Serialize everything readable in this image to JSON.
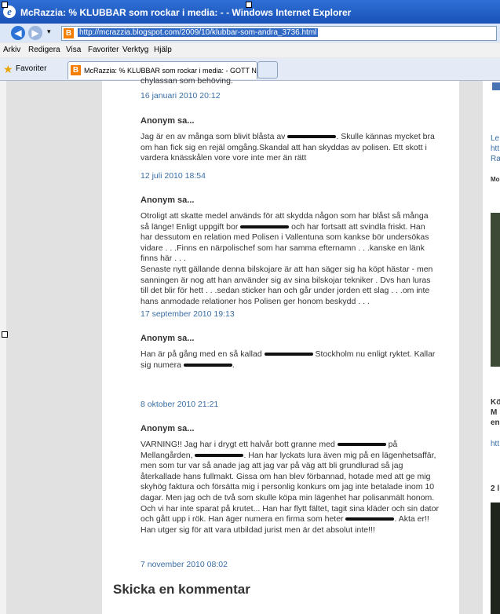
{
  "window": {
    "title_prefix": "McRazzia: % KLUBBAR som rockar i media: -",
    "title_app": "Windows Internet Explorer"
  },
  "address": {
    "url": "http://mcrazzia.blogspot.com/2009/10/klubbar-som-andra_3736.html"
  },
  "menu": [
    "Arkiv",
    "Redigera",
    "Visa",
    "Favoriter",
    "Verktyg",
    "Hjälp"
  ],
  "favorites_label": "Favoriter",
  "tab_title": "McRazzia: % KLUBBAR som rockar i media: - GOTT N...",
  "top_fragment": "chylassan som behöving.",
  "top_time": "16 januari 2010 20:12",
  "comments": [
    {
      "author": "Anonym sa...",
      "body": "Jag är en av många som blivit blåsta av [redacted]. Skulle kännas mycket bra om han fick sig en rejäl omgång.Skandal att han skyddas av polisen. Ett skott i vardera knässkålen vore vore inte mer än rätt",
      "time": "12 juli 2010 18:54"
    },
    {
      "author": "Anonym sa...",
      "body": "Otroligt att skatte medel används för att skydda någon som har blåst så många så länge! Enligt uppgift bor [redacted] och har fortsatt att svindla friskt. Han har dessutom en relation med Polisen i Vallentuna som kankse bör undersökas vidare . . .Finns en närpolischef som har samma efternamn . . .kanske en länk finns här . . .\nSenaste nytt gällande denna bilskojare är att han säger sig ha köpt hästar - men sanningen är nog att han använder sig av sina bilskojar tekniker . Dvs han luras till det blir för hett . . .sedan sticker han och går under jorden ett slag . . .om inte hans anmodade relationer hos Polisen ger honom beskydd . . .",
      "time": "17 september 2010 19:13"
    },
    {
      "author": "Anonym sa...",
      "body": "Han är på gång med en så kallad [redacted] Stockholm nu enligt ryktet. Kallar sig numera [redacted].",
      "time": "8 oktober 2010 21:21"
    },
    {
      "author": "Anonym sa...",
      "body": "VARNING!! Jag har i drygt ett halvår bott granne med [redacted] på Mellangården, [redacted]. Han har lyckats lura även mig på en lägenhetsaffär, men som tur var så anade jag att jag var på väg att bli grundlurad så jag återkallade hans fullmakt. Gissa om han blev förbannad, hotade med att ge mig skyhög faktura och försätta mig i personlig konkurs om jag inte betalade inom 10 dagar. Men jag och de två som skulle köpa min lägenhet har polisanmält honom. Och vi har inte sparat på krutet... Han har flytt fältet, tagit sina kläder och sin dator och gått upp i rök. Han äger numera en firma som heter [redacted]. Akta er!! Han utger sig för att vara utbildad jurist men är det absolut inte!!!",
      "time": "7 november 2010 08:02"
    }
  ],
  "post_comment_heading": "Skicka en kommentar",
  "sidebar": {
    "s1": "Le",
    "s2": "htt",
    "s3": "Ra",
    "s4": "Mo",
    "s5": "Kö",
    "s6": "M",
    "s7": "en",
    "s8": "htt",
    "s9": "2 l"
  }
}
